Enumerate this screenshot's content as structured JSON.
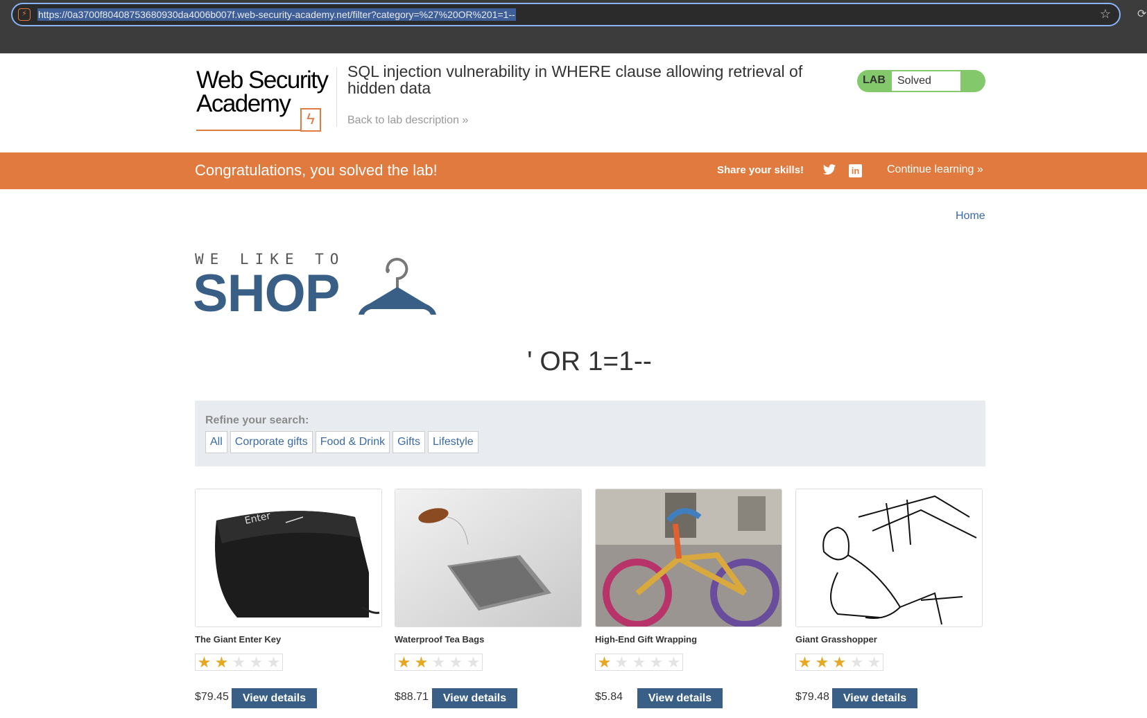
{
  "browser": {
    "url": "https://0a3700f80408753680930da4006b007f.web-security-academy.net/filter?category=%27%20OR%201=1--"
  },
  "lab": {
    "logo_line1": "Web Security",
    "logo_line2": "Academy",
    "title": "SQL injection vulnerability in WHERE clause allowing retrieval of hidden data",
    "back_link": "Back to lab description",
    "status_label": "LAB",
    "status_value": "Solved"
  },
  "banner": {
    "message": "Congratulations, you solved the lab!",
    "share": "Share your skills!",
    "continue": "Continue learning",
    "color": "#e07a3e"
  },
  "shop": {
    "home": "Home",
    "tagline": "WE LIKE TO",
    "brand": "SHOP",
    "search_term": "' OR 1=1--",
    "refine_label": "Refine your search:",
    "filters": [
      "All",
      "Corporate gifts",
      "Food & Drink",
      "Gifts",
      "Lifestyle"
    ],
    "accent": "#3a5f86"
  },
  "products": [
    {
      "name": "The Giant Enter Key",
      "rating": 2,
      "price": "$79.45",
      "button": "View details",
      "image": "giant-enter-key-image"
    },
    {
      "name": "Waterproof Tea Bags",
      "rating": 2,
      "price": "$88.71",
      "button": "View details",
      "image": "tea-bag-image"
    },
    {
      "name": "High-End Gift Wrapping",
      "rating": 1,
      "price": "$5.84",
      "button": "View details",
      "image": "knitted-bicycle-image"
    },
    {
      "name": "Giant Grasshopper",
      "rating": 3,
      "price": "$79.48",
      "button": "View details",
      "image": "grasshopper-sketch-image"
    }
  ]
}
